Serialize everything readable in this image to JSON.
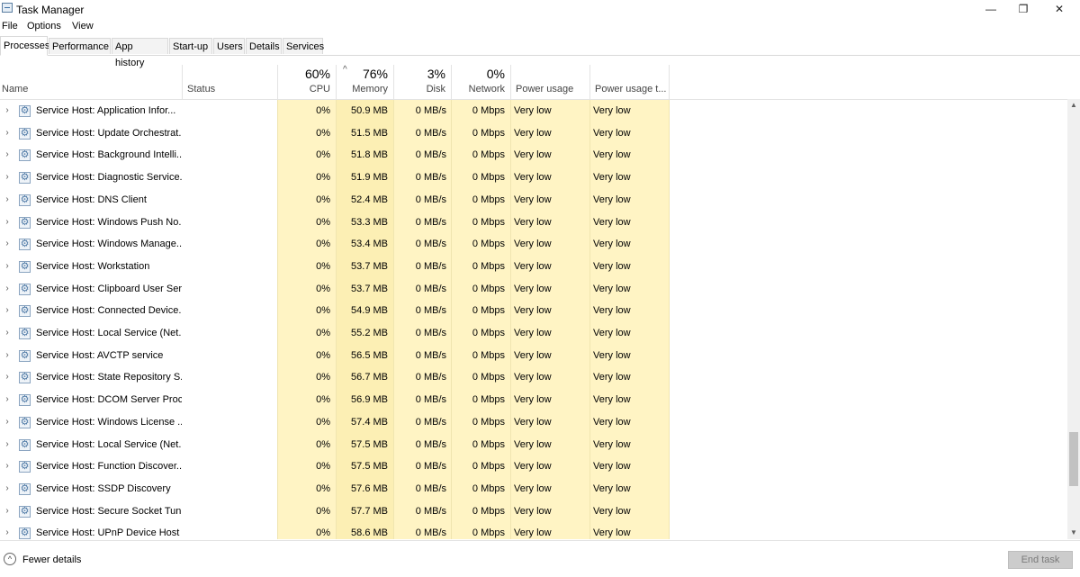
{
  "window": {
    "title": "Task Manager",
    "minimize_glyph": "—",
    "maximize_glyph": "❐",
    "close_glyph": "✕",
    "icon": "task-manager-icon"
  },
  "menu": [
    "File",
    "Options",
    "View"
  ],
  "tabs": [
    "Processes",
    "Performance",
    "App history",
    "Start-up",
    "Users",
    "Details",
    "Services"
  ],
  "active_tab": "Processes",
  "header": {
    "name": "Name",
    "status": "Status",
    "cpu_pct": "60%",
    "cpu": "CPU",
    "sort_indicator": "^",
    "memory_pct": "76%",
    "memory": "Memory",
    "disk_pct": "3%",
    "disk": "Disk",
    "network_pct": "0%",
    "network": "Network",
    "power": "Power usage",
    "power_trend": "Power usage t..."
  },
  "colors": {
    "cpu_band": "#fff4c4",
    "memory_band": "#fcefb4",
    "accent": "#4f7aa6"
  },
  "rows": [
    {
      "name": "Service Host: Application Infor...",
      "cpu": "0%",
      "memory": "50.9 MB",
      "disk": "0 MB/s",
      "network": "0 Mbps",
      "power": "Very low",
      "power_trend": "Very low"
    },
    {
      "name": "Service Host: Update Orchestrat...",
      "cpu": "0%",
      "memory": "51.5 MB",
      "disk": "0 MB/s",
      "network": "0 Mbps",
      "power": "Very low",
      "power_trend": "Very low"
    },
    {
      "name": "Service Host: Background Intelli...",
      "cpu": "0%",
      "memory": "51.8 MB",
      "disk": "0 MB/s",
      "network": "0 Mbps",
      "power": "Very low",
      "power_trend": "Very low"
    },
    {
      "name": "Service Host: Diagnostic Service...",
      "cpu": "0%",
      "memory": "51.9 MB",
      "disk": "0 MB/s",
      "network": "0 Mbps",
      "power": "Very low",
      "power_trend": "Very low"
    },
    {
      "name": "Service Host: DNS Client",
      "cpu": "0%",
      "memory": "52.4 MB",
      "disk": "0 MB/s",
      "network": "0 Mbps",
      "power": "Very low",
      "power_trend": "Very low"
    },
    {
      "name": "Service Host: Windows Push No...",
      "cpu": "0%",
      "memory": "53.3 MB",
      "disk": "0 MB/s",
      "network": "0 Mbps",
      "power": "Very low",
      "power_trend": "Very low"
    },
    {
      "name": "Service Host: Windows Manage...",
      "cpu": "0%",
      "memory": "53.4 MB",
      "disk": "0 MB/s",
      "network": "0 Mbps",
      "power": "Very low",
      "power_trend": "Very low"
    },
    {
      "name": "Service Host: Workstation",
      "cpu": "0%",
      "memory": "53.7 MB",
      "disk": "0 MB/s",
      "network": "0 Mbps",
      "power": "Very low",
      "power_trend": "Very low"
    },
    {
      "name": "Service Host: Clipboard User Ser...",
      "cpu": "0%",
      "memory": "53.7 MB",
      "disk": "0 MB/s",
      "network": "0 Mbps",
      "power": "Very low",
      "power_trend": "Very low"
    },
    {
      "name": "Service Host: Connected Device...",
      "cpu": "0%",
      "memory": "54.9 MB",
      "disk": "0 MB/s",
      "network": "0 Mbps",
      "power": "Very low",
      "power_trend": "Very low"
    },
    {
      "name": "Service Host: Local Service (Net...",
      "cpu": "0%",
      "memory": "55.2 MB",
      "disk": "0 MB/s",
      "network": "0 Mbps",
      "power": "Very low",
      "power_trend": "Very low"
    },
    {
      "name": "Service Host: AVCTP service",
      "cpu": "0%",
      "memory": "56.5 MB",
      "disk": "0 MB/s",
      "network": "0 Mbps",
      "power": "Very low",
      "power_trend": "Very low"
    },
    {
      "name": "Service Host: State Repository S...",
      "cpu": "0%",
      "memory": "56.7 MB",
      "disk": "0 MB/s",
      "network": "0 Mbps",
      "power": "Very low",
      "power_trend": "Very low"
    },
    {
      "name": "Service Host: DCOM Server Proc...",
      "cpu": "0%",
      "memory": "56.9 MB",
      "disk": "0 MB/s",
      "network": "0 Mbps",
      "power": "Very low",
      "power_trend": "Very low"
    },
    {
      "name": "Service Host: Windows License ...",
      "cpu": "0%",
      "memory": "57.4 MB",
      "disk": "0 MB/s",
      "network": "0 Mbps",
      "power": "Very low",
      "power_trend": "Very low"
    },
    {
      "name": "Service Host: Local Service (Net...",
      "cpu": "0%",
      "memory": "57.5 MB",
      "disk": "0 MB/s",
      "network": "0 Mbps",
      "power": "Very low",
      "power_trend": "Very low"
    },
    {
      "name": "Service Host: Function Discover...",
      "cpu": "0%",
      "memory": "57.5 MB",
      "disk": "0 MB/s",
      "network": "0 Mbps",
      "power": "Very low",
      "power_trend": "Very low"
    },
    {
      "name": "Service Host: SSDP Discovery",
      "cpu": "0%",
      "memory": "57.6 MB",
      "disk": "0 MB/s",
      "network": "0 Mbps",
      "power": "Very low",
      "power_trend": "Very low"
    },
    {
      "name": "Service Host: Secure Socket Tun...",
      "cpu": "0%",
      "memory": "57.7 MB",
      "disk": "0 MB/s",
      "network": "0 Mbps",
      "power": "Very low",
      "power_trend": "Very low"
    },
    {
      "name": "Service Host: UPnP Device Host",
      "cpu": "0%",
      "memory": "58.6 MB",
      "disk": "0 MB/s",
      "network": "0 Mbps",
      "power": "Very low",
      "power_trend": "Very low"
    }
  ],
  "footer": {
    "fewer_details": "Fewer details",
    "fewer_glyph": "^",
    "end_task": "End task"
  },
  "scrollbar": {
    "up_glyph": "▲",
    "down_glyph": "▼"
  }
}
